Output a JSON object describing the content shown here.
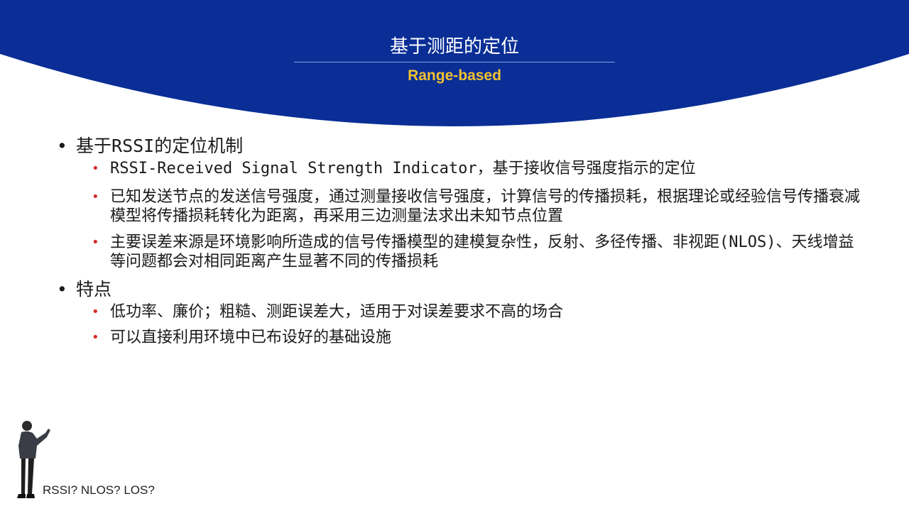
{
  "header": {
    "title_zh": "基于测距的定位",
    "title_en": "Range-based"
  },
  "bullets": [
    {
      "label_pre": "基于",
      "label_mono": "RSSI",
      "label_post": "的定位机制",
      "children": [
        {
          "mono": "RSSI-Received Signal Strength Indicator",
          "text": "，基于接收信号强度指示的定位"
        },
        {
          "text": "已知发送节点的发送信号强度，通过测量接收信号强度，计算信号的传播损耗，根据理论或经验信号传播衰减模型将传播损耗转化为距离，再采用三边测量法求出未知节点位置"
        },
        {
          "pre": "主要误差来源是环境影响所造成的信号传播模型的建模复杂性，反射、多径传播、非视距",
          "mono": "(NLOS)",
          "post": "、天线增益等问题都会对相同距离产生显著不同的传播损耗"
        }
      ]
    },
    {
      "label": "特点",
      "children": [
        {
          "text": "低功率、廉价；粗糙、测距误差大，适用于对误差要求不高的场合"
        },
        {
          "text": "可以直接利用环境中已布设好的基础设施"
        }
      ]
    }
  ],
  "footer_note": "RSSI? NLOS? LOS?",
  "colors": {
    "banner": "#0a2e96",
    "title_en": "#f2c230",
    "sub_bullet": "#d42b2b"
  }
}
